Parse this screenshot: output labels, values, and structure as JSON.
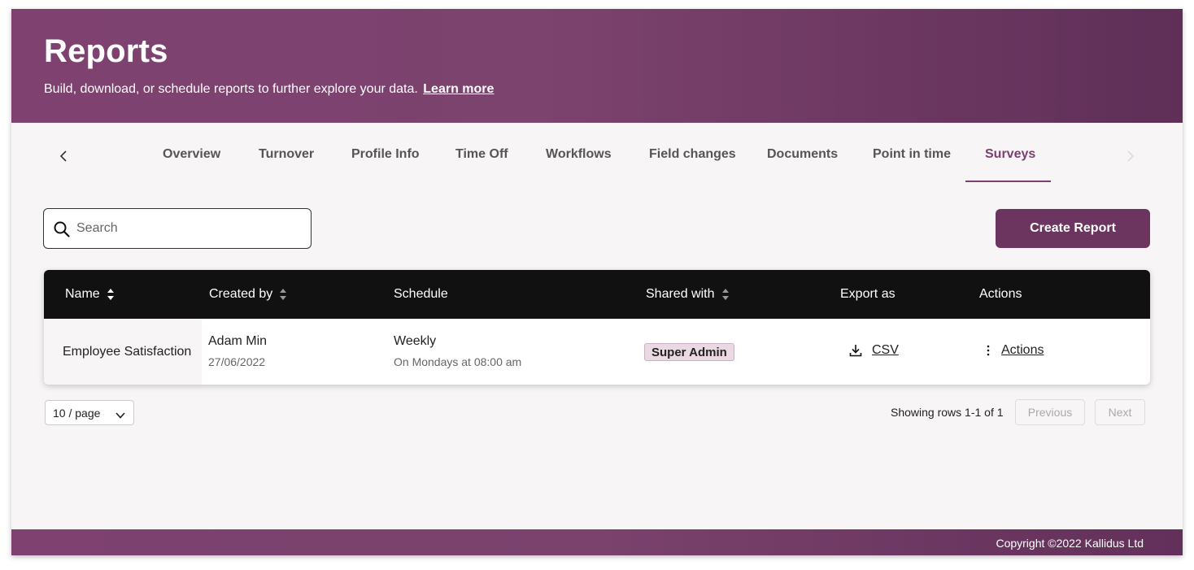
{
  "header": {
    "title": "Reports",
    "subtitle": "Build, download, or schedule reports to further explore your data.",
    "learn_more": "Learn more"
  },
  "tabs": [
    {
      "label": "Overview"
    },
    {
      "label": "Turnover"
    },
    {
      "label": "Profile Info"
    },
    {
      "label": "Time Off"
    },
    {
      "label": "Workflows"
    },
    {
      "label": "Field changes"
    },
    {
      "label": "Documents"
    },
    {
      "label": "Point in time"
    },
    {
      "label": "Surveys",
      "active": true
    }
  ],
  "search": {
    "placeholder": "Search",
    "value": ""
  },
  "create_report_label": "Create Report",
  "table": {
    "columns": [
      "Name",
      "Created by",
      "Schedule",
      "Shared with",
      "Export as",
      "Actions"
    ],
    "rows": [
      {
        "name": "Employee Satisfaction",
        "created_by": "Adam Min",
        "created_date": "27/06/2022",
        "schedule": "Weekly",
        "schedule_detail": "On Mondays at 08:00 am",
        "shared_with": "Super Admin",
        "export": "CSV",
        "actions": "Actions"
      }
    ]
  },
  "pagination": {
    "page_size": "10 / page",
    "rows_info": "Showing rows 1-1 of 1",
    "previous": "Previous",
    "next": "Next"
  },
  "footer": {
    "copyright": "Copyright ©2022 Kallidus Ltd"
  },
  "colors": {
    "brand": "#7d3e70",
    "button": "#6b3560",
    "table_header": "#111111",
    "badge_bg": "#ead9e3"
  }
}
